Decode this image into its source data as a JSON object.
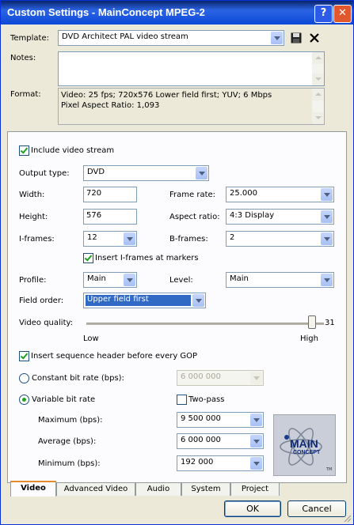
{
  "window": {
    "title": "Custom Settings - MainConcept MPEG-2",
    "help_label": "?",
    "close_label": "✕"
  },
  "template": {
    "label": "Template:",
    "value": "DVD Architect PAL video stream",
    "save_icon": "save-icon",
    "delete_icon": "delete-icon"
  },
  "notes": {
    "label": "Notes:",
    "value": ""
  },
  "format": {
    "label": "Format:",
    "line1": "Video: 25 fps; 720x576 Lower field first; YUV; 6 Mbps",
    "line2": "Pixel Aspect Ratio: 1,093"
  },
  "video": {
    "include_label": "Include video stream",
    "include_checked": true,
    "output_type_label": "Output type:",
    "output_type": "DVD",
    "width_label": "Width:",
    "width": "720",
    "height_label": "Height:",
    "height": "576",
    "frame_rate_label": "Frame rate:",
    "frame_rate": "25.000",
    "aspect_ratio_label": "Aspect ratio:",
    "aspect_ratio": "4:3 Display",
    "iframes_label": "I-frames:",
    "iframes": "12",
    "bframes_label": "B-frames:",
    "bframes": "2",
    "insert_iframes_label": "Insert I-frames at markers",
    "insert_iframes_checked": true,
    "profile_label": "Profile:",
    "profile": "Main",
    "level_label": "Level:",
    "level": "Main",
    "field_order_label": "Field order:",
    "field_order": "Upper field first",
    "quality_label": "Video quality:",
    "quality_value": "31",
    "quality_low": "Low",
    "quality_high": "High",
    "quality_fraction": 0.95,
    "seq_header_label": "Insert sequence header before every GOP",
    "seq_header_checked": true,
    "cbr_label": "Constant bit rate (bps):",
    "cbr_value": "6 000 000",
    "vbr_label": "Variable bit rate",
    "two_pass_label": "Two-pass",
    "max_label": "Maximum (bps):",
    "max_value": "9 500 000",
    "avg_label": "Average (bps):",
    "avg_value": "6 000 000",
    "min_label": "Minimum (bps):",
    "min_value": "192 000",
    "logo_text_1": "MAIN",
    "logo_text_2": "CONCEPT",
    "logo_tm": "TM"
  },
  "tabs": [
    "Video",
    "Advanced Video",
    "Audio",
    "System",
    "Project"
  ],
  "buttons": {
    "ok": "OK",
    "cancel": "Cancel"
  },
  "colors": {
    "title_bar": "#0a246a",
    "selection": "#316ac5",
    "accent": "#21a121"
  }
}
